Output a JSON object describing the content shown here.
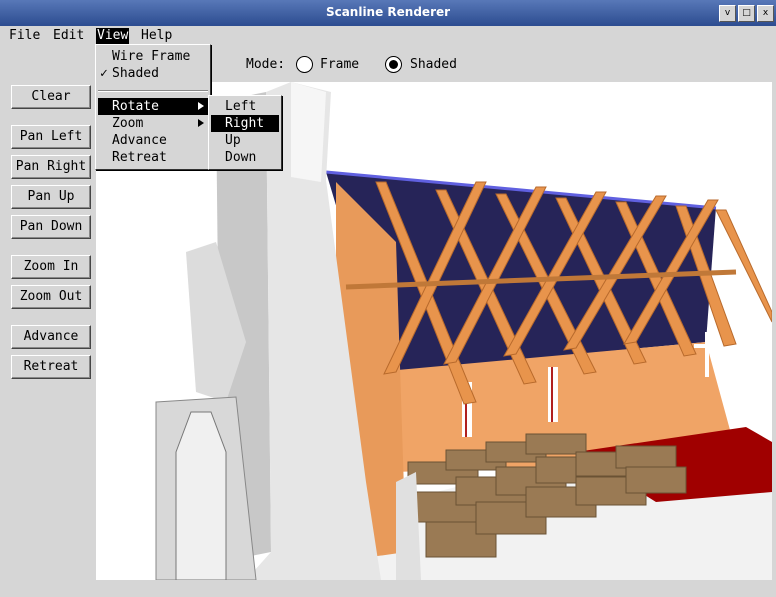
{
  "window": {
    "title": "Scanline Renderer",
    "btn_minimize": "v",
    "btn_maximize": "□",
    "btn_close": "x"
  },
  "menubar": {
    "file": "File",
    "edit": "Edit",
    "view": "View",
    "help": "Help"
  },
  "mode": {
    "label": "Mode:",
    "options": [
      "Frame",
      "Shaded"
    ],
    "selected": "Shaded"
  },
  "buttons": {
    "clear": "Clear",
    "pan_left": "Pan Left",
    "pan_right": "Pan Right",
    "pan_up": "Pan Up",
    "pan_down": "Pan Down",
    "zoom_in": "Zoom In",
    "zoom_out": "Zoom Out",
    "advance": "Advance",
    "retreat": "Retreat"
  },
  "view_menu": {
    "wire_frame": "Wire Frame",
    "shaded": "Shaded",
    "shaded_check": "✓",
    "rotate": "Rotate",
    "zoom": "Zoom",
    "advance": "Advance",
    "retreat": "Retreat"
  },
  "rotate_menu": {
    "left": "Left",
    "right": "Right",
    "up": "Up",
    "down": "Down",
    "highlighted": "Right"
  },
  "colors": {
    "titlebar": "#3a5ca8",
    "wall": "#f0a060",
    "beam": "#d0803c",
    "roof": "#2a2860",
    "tower": "#d0d0d0",
    "carpet": "#a00000",
    "pew": "#9a7a54"
  },
  "scene_icon": "church-interior-render"
}
